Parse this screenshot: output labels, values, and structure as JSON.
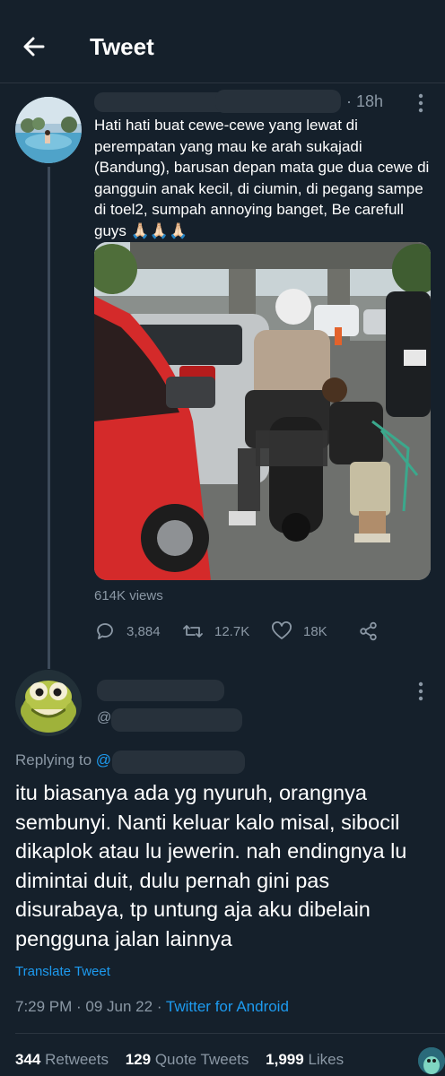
{
  "header": {
    "title": "Tweet"
  },
  "tweet": {
    "time_ago": "18h",
    "text": "Hati hati buat cewe-cewe yang lewat di perempatan yang mau ke arah sukajadi (Bandung), barusan depan mata gue dua cewe di gangguin anak kecil, di ciumin, di pegang sampe di toel2, sumpah annoying banget, Be carefull guys 🙏🏻🙏🏻🙏🏻",
    "views": "614K views",
    "replies": "3,884",
    "retweets": "12.7K",
    "likes": "18K"
  },
  "reply": {
    "handle_prefix": "@",
    "replying_label": "Replying to",
    "replying_mention": "@",
    "text": "itu biasanya ada yg nyuruh, orangnya sembunyi. Nanti keluar kalo misal, sibocil dikaplok atau lu jewerin. nah endingnya lu dimintai duit, dulu pernah gini pas disurabaya, tp untung aja aku dibelain pengguna jalan lainnya",
    "translate_label": "Translate Tweet",
    "timestamp": "7:29 PM · 09 Jun 22 · ",
    "source": "Twitter for Android",
    "stats": {
      "retweets_count": "344",
      "retweets_label": "Retweets",
      "quotes_count": "129",
      "quotes_label": "Quote Tweets",
      "likes_count": "1,999",
      "likes_label": "Likes"
    }
  },
  "colors": {
    "background": "#15202b",
    "secondary_text": "#8b98a5",
    "link": "#1d9bf0"
  }
}
